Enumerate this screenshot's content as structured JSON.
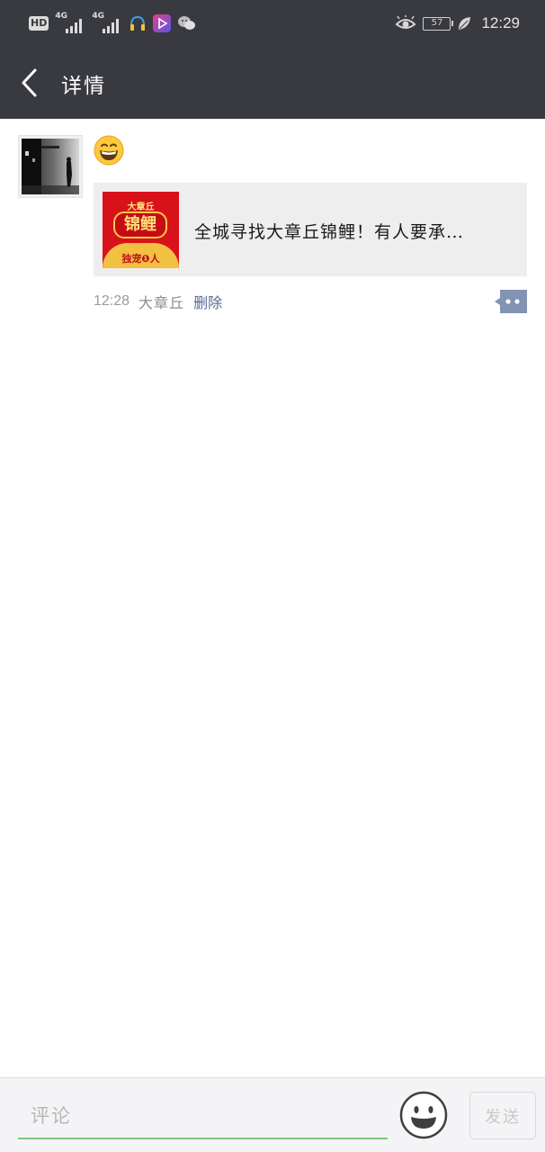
{
  "status_bar": {
    "hd_label": "HD",
    "network1": "4G",
    "network2": "4G",
    "battery": "57",
    "time": "12:29"
  },
  "nav": {
    "title": "详情"
  },
  "moment": {
    "emoji_icon": "grinning-face-emoji",
    "shared_link": {
      "title": "全城寻找大章丘锦鲤！有人要承…",
      "thumbnail": {
        "top_text": "大章丘",
        "main_text": "锦鲤",
        "bottom_text": "独宠❶人"
      }
    },
    "meta": {
      "time": "12:28",
      "source": "大章丘",
      "delete_label": "删除"
    }
  },
  "comment_bar": {
    "placeholder": "评论",
    "send_label": "发送"
  },
  "colors": {
    "header_bg": "#393a3f",
    "link_blue": "#576b95",
    "input_underline": "#7cc77a",
    "card_bg": "#eeeeee"
  }
}
